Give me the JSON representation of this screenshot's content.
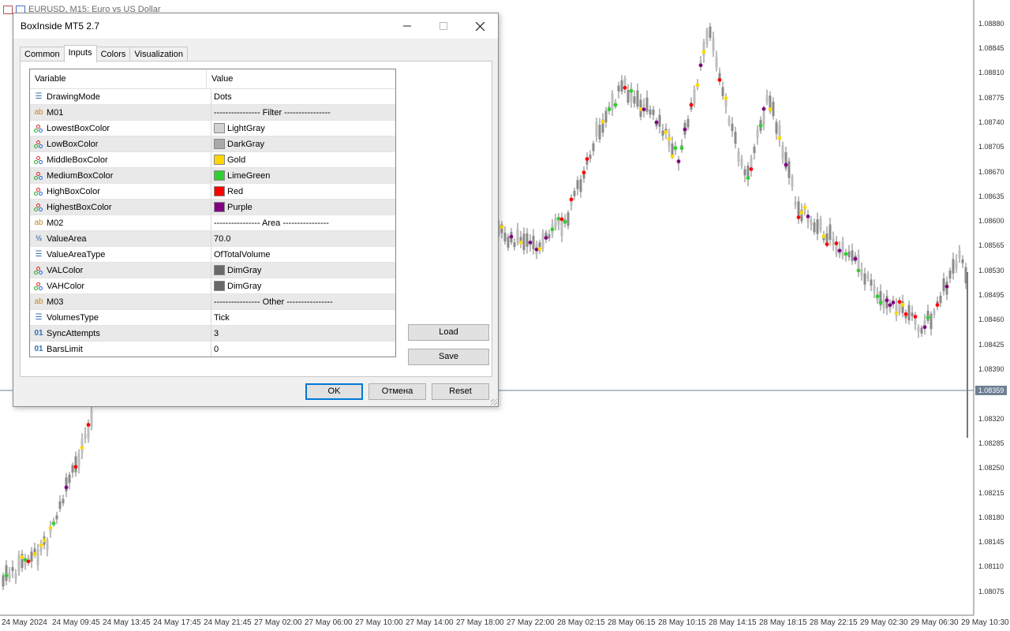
{
  "chart": {
    "symbol": "EURUSD, M15:  Euro vs US Dollar",
    "current_price": "1.08359",
    "price_scale": [
      "1.08880",
      "1.08845",
      "1.08810",
      "1.08775",
      "1.08740",
      "1.08705",
      "1.08670",
      "1.08635",
      "1.08600",
      "1.08565",
      "1.08530",
      "1.08495",
      "1.08460",
      "1.08425",
      "1.08390",
      "1.08320",
      "1.08285",
      "1.08250",
      "1.08215",
      "1.08180",
      "1.08145",
      "1.08110",
      "1.08075"
    ],
    "time_scale": [
      "24 May 2024",
      "24 May 09:45",
      "24 May 13:45",
      "24 May 17:45",
      "24 May 21:45",
      "27 May 02:00",
      "27 May 06:00",
      "27 May 10:00",
      "27 May 14:00",
      "27 May 18:00",
      "27 May 22:00",
      "28 May 02:15",
      "28 May 06:15",
      "28 May 10:15",
      "28 May 14:15",
      "28 May 18:15",
      "28 May 22:15",
      "29 May 02:30",
      "29 May 06:30",
      "29 May 10:30"
    ]
  },
  "dialog": {
    "title": "BoxInside MT5 2.7",
    "tabs": [
      "Common",
      "Inputs",
      "Colors",
      "Visualization"
    ],
    "active_tab": "Inputs",
    "grid_headers": {
      "variable": "Variable",
      "value": "Value"
    },
    "rows": [
      {
        "variable": "DrawingMode",
        "value": "Dots",
        "icon": "enum-icon"
      },
      {
        "variable": "M01",
        "value": "---------------- Filter ----------------",
        "icon": "string-icon"
      },
      {
        "variable": "LowestBoxColor",
        "value": "LightGray",
        "icon": "color-icon",
        "swatch": "#d3d3d3"
      },
      {
        "variable": "LowBoxColor",
        "value": "DarkGray",
        "icon": "color-icon",
        "swatch": "#a9a9a9"
      },
      {
        "variable": "MiddleBoxColor",
        "value": "Gold",
        "icon": "color-icon",
        "swatch": "#ffd700"
      },
      {
        "variable": "MediumBoxColor",
        "value": "LimeGreen",
        "icon": "color-icon",
        "swatch": "#32cd32"
      },
      {
        "variable": "HighBoxColor",
        "value": "Red",
        "icon": "color-icon",
        "swatch": "#ff0000"
      },
      {
        "variable": "HighestBoxColor",
        "value": "Purple",
        "icon": "color-icon",
        "swatch": "#800080"
      },
      {
        "variable": "M02",
        "value": "---------------- Area ----------------",
        "icon": "string-icon"
      },
      {
        "variable": "ValueArea",
        "value": "70.0",
        "icon": "double-icon"
      },
      {
        "variable": "ValueAreaType",
        "value": "OfTotalVolume",
        "icon": "enum-icon"
      },
      {
        "variable": "VALColor",
        "value": "DimGray",
        "icon": "color-icon",
        "swatch": "#696969"
      },
      {
        "variable": "VAHColor",
        "value": "DimGray",
        "icon": "color-icon",
        "swatch": "#696969"
      },
      {
        "variable": "M03",
        "value": "---------------- Other ----------------",
        "icon": "string-icon"
      },
      {
        "variable": "VolumesType",
        "value": "Tick",
        "icon": "enum-icon"
      },
      {
        "variable": "SyncAttempts",
        "value": "3",
        "icon": "int-icon"
      },
      {
        "variable": "BarsLimit",
        "value": "0",
        "icon": "int-icon"
      }
    ],
    "side_buttons": {
      "load": "Load",
      "save": "Save"
    },
    "footer_buttons": {
      "ok": "OK",
      "cancel": "Отмена",
      "reset": "Reset"
    }
  }
}
